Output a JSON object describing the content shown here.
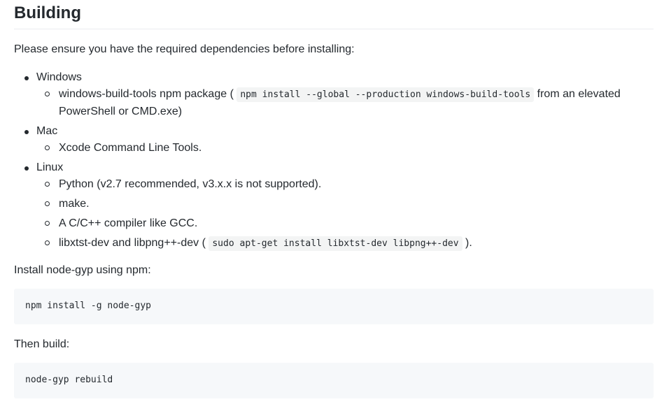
{
  "heading": "Building",
  "intro": "Please ensure you have the required dependencies before installing:",
  "dependencies": {
    "windows": {
      "label": "Windows",
      "item1_prefix": "windows-build-tools npm package (",
      "item1_code": "npm install --global --production windows-build-tools",
      "item1_suffix": "from an elevated PowerShell or CMD.exe)"
    },
    "mac": {
      "label": "Mac",
      "item1": "Xcode Command Line Tools."
    },
    "linux": {
      "label": "Linux",
      "item1": "Python (v2.7 recommended, v3.x.x is not supported).",
      "item2": "make.",
      "item3": "A C/C++ compiler like GCC.",
      "item4_prefix": "libxtst-dev and libpng++-dev (",
      "item4_code": "sudo apt-get install libxtst-dev libpng++-dev",
      "item4_suffix": ")."
    }
  },
  "install_text": "Install node-gyp using npm:",
  "install_code": "npm install -g node-gyp",
  "build_text": "Then build:",
  "build_code": "node-gyp rebuild"
}
